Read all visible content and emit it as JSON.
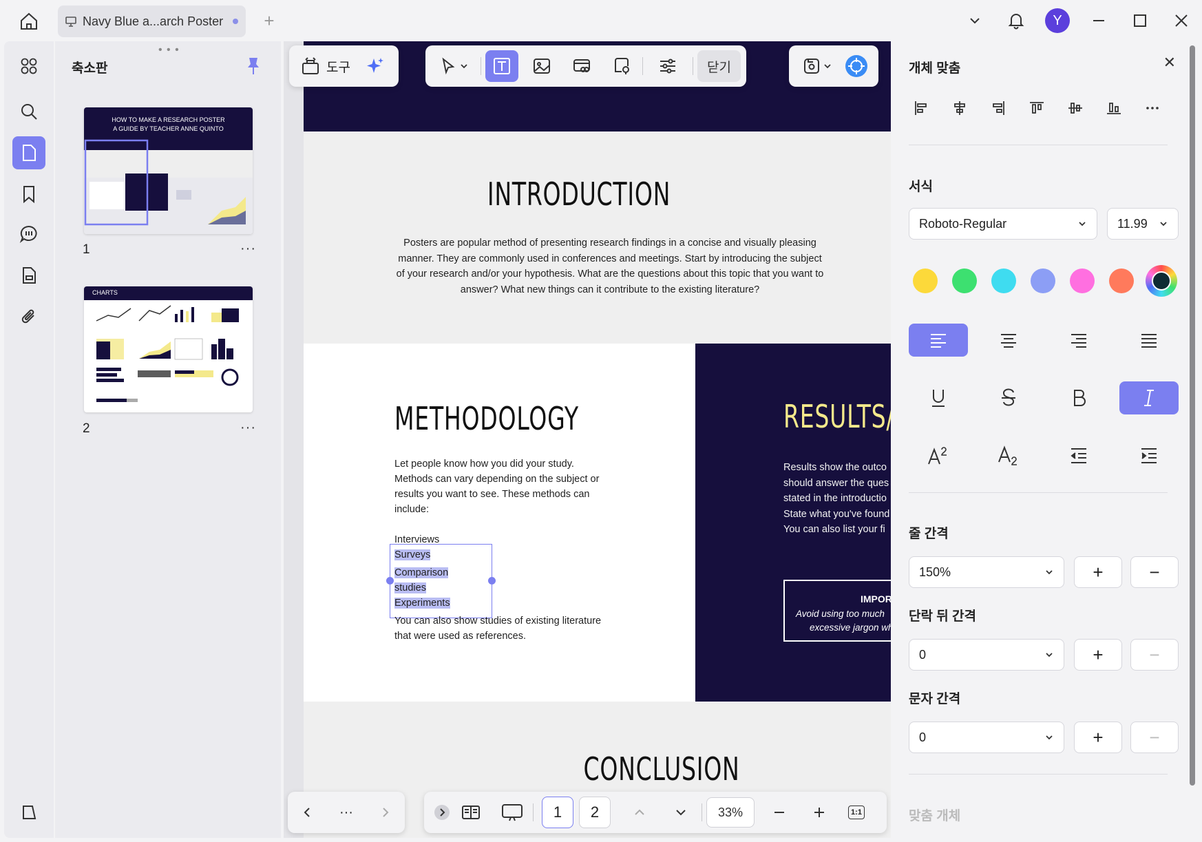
{
  "tab": {
    "title": "Navy Blue a...arch Poster"
  },
  "window": {
    "avatar_letter": "Y"
  },
  "thumbs": {
    "title": "축소판",
    "pages": [
      {
        "num": "1",
        "more": "···"
      },
      {
        "num": "2",
        "more": "···"
      }
    ],
    "thumb1": {
      "title1": "HOW TO MAKE A RESEARCH POSTER",
      "title2": "A GUIDE BY TEACHER ANNE QUINTO"
    },
    "thumb2": {
      "header": "CHARTS"
    }
  },
  "toolbar": {
    "tools_label": "도구",
    "close_label": "닫기"
  },
  "document": {
    "intro_heading": "INTRODUCTION",
    "intro_text": "Posters are popular method of presenting research findings in a concise and visually pleasing manner. They are commonly used in conferences and meetings. Start by introducing the subject of your research and/or your hypothesis. What are the questions about this topic that you want to answer? What new things can it contribute to the existing literature?",
    "method_heading": "METHODOLOGY",
    "method_text": "Let people know how you did your study. Methods can vary depending on the subject or results you want to see. These methods can include:",
    "method_list": [
      "Interviews",
      "Surveys",
      "Comparison",
      "studies",
      "Experiments"
    ],
    "method_text2": "You can also show studies of existing literature that were used as references.",
    "results_heading": "RESULTS/F",
    "results_lines": [
      "Results show the outco",
      "should answer the ques",
      "stated in the introductio",
      "State what you've found",
      "You can also list your fi"
    ],
    "important_title": "IMPOR",
    "important_lines": [
      "Avoid using too much",
      "excessive jargon wh"
    ],
    "conclusion_heading": "CONCLUSION"
  },
  "bottombar": {
    "more": "···",
    "pages": [
      "1",
      "2"
    ],
    "zoom": "33%",
    "fit_label": "1:1"
  },
  "props": {
    "align_title": "개체 맞춤",
    "format_title": "서식",
    "font_name": "Roboto-Regular",
    "font_size": "11.99",
    "colors": [
      "#fcd93a",
      "#3de070",
      "#3fdcf0",
      "#8c9ef5",
      "#ff6fe0",
      "#ff7a5c",
      "#0f2b33"
    ],
    "line_spacing_title": "줄 간격",
    "line_spacing_value": "150%",
    "para_after_title": "단락 뒤 간격",
    "para_after_value": "0",
    "char_spacing_title": "문자 간격",
    "char_spacing_value": "0",
    "fit_object_title": "맞춤 개체",
    "plus": "+",
    "minus": "−"
  }
}
